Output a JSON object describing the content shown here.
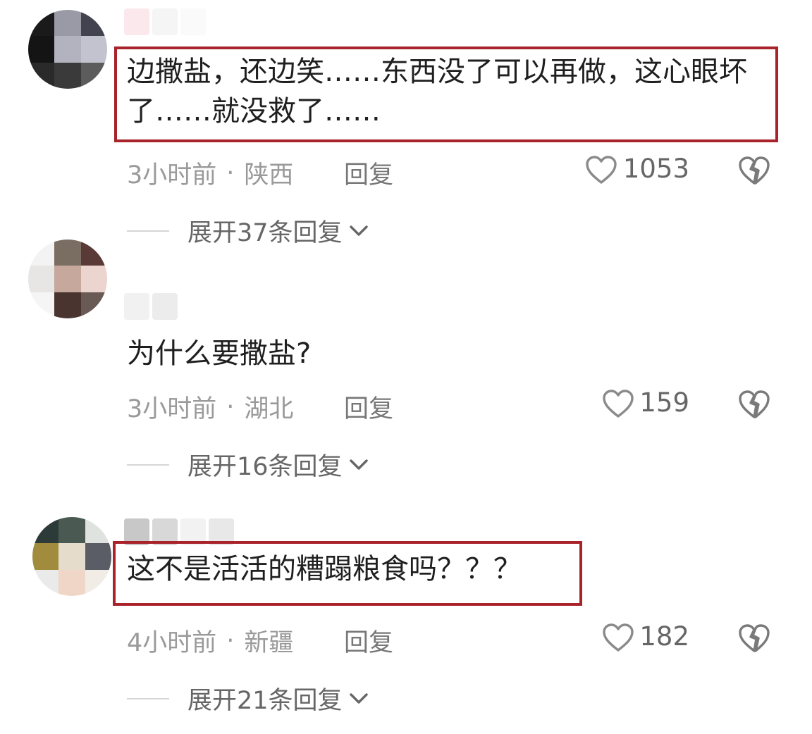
{
  "comments": [
    {
      "text": "边撒盐，还边笑……东西没了可以再做，这心眼坏了……就没救了……",
      "time": "3小时前",
      "separator": "·",
      "location": "陕西",
      "reply_label": "回复",
      "likes": "1053",
      "expand_label": "展开37条回复",
      "highlighted": true,
      "avatar_colors": [
        "#1a1a1a",
        "#9a9aa6",
        "#43434f",
        "#141414",
        "#b3b3c0",
        "#c3c3cf",
        "#2a2a2a",
        "#3a3a3a",
        "#5c5c5c"
      ],
      "name_colors": [
        "#fbe8ec",
        "#f5f5f5",
        "#fafafa"
      ]
    },
    {
      "text": "为什么要撒盐?",
      "time": "3小时前",
      "separator": "·",
      "location": "湖北",
      "reply_label": "回复",
      "likes": "159",
      "expand_label": "展开16条回复",
      "highlighted": false,
      "avatar_colors": [
        "#f3f3f3",
        "#7a6e62",
        "#5a3a36",
        "#e8e6e4",
        "#c6a89c",
        "#ecd4cf",
        "#f5f5f5",
        "#4a3430",
        "#6a5a55"
      ],
      "name_colors": [
        "#f1f1f1",
        "#ececec"
      ]
    },
    {
      "text": "这不是活活的糟蹋粮食吗？？？",
      "time": "4小时前",
      "separator": "·",
      "location": "新疆",
      "reply_label": "回复",
      "likes": "182",
      "expand_label": "展开21条回复",
      "highlighted": true,
      "avatar_colors": [
        "#2c3a38",
        "#4a5a52",
        "#dfe3df",
        "#a08c3c",
        "#e6dccc",
        "#5a5c66",
        "#eaeaea",
        "#f0d6c6",
        "#f2ece6"
      ],
      "name_colors": [
        "#c8c8c8",
        "#d8d8d8",
        "#f2f2f2",
        "#e8e8e8"
      ]
    }
  ],
  "colors": {
    "highlight_border": "#a8232a",
    "text": "#1f1f1f",
    "meta": "#9a9a9a"
  },
  "icons": {
    "like": "heart-outline-icon",
    "dislike": "broken-heart-icon",
    "expand": "chevron-down-icon"
  }
}
